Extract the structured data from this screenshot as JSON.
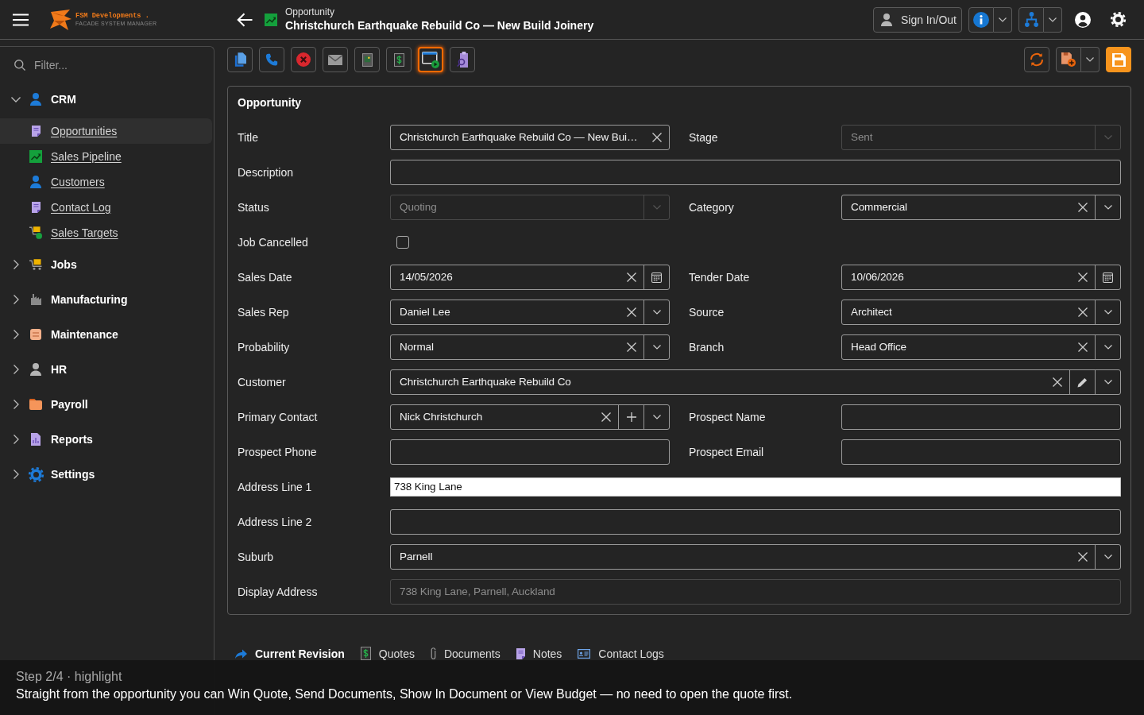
{
  "brand": {
    "name": "FSM Developments .",
    "tagline": "FACADE SYSTEM MANAGER"
  },
  "header": {
    "section": "Opportunity",
    "title": "Christchurch Earthquake Rebuild Co — New Build Joinery"
  },
  "account": {
    "sign_in_label": "Sign In/Out"
  },
  "sidebar": {
    "filter": {
      "placeholder": "Filter..."
    },
    "groups": [
      {
        "label": "CRM",
        "expanded": true,
        "children": [
          {
            "label": "Opportunities",
            "selected": true
          },
          {
            "label": "Sales Pipeline",
            "selected": false
          },
          {
            "label": "Customers",
            "selected": false
          },
          {
            "label": "Contact Log",
            "selected": false
          },
          {
            "label": "Sales Targets",
            "selected": false
          }
        ]
      },
      {
        "label": "Jobs",
        "expanded": false
      },
      {
        "label": "Manufacturing",
        "expanded": false
      },
      {
        "label": "Maintenance",
        "expanded": false
      },
      {
        "label": "HR",
        "expanded": false
      },
      {
        "label": "Payroll",
        "expanded": false
      },
      {
        "label": "Reports",
        "expanded": false
      },
      {
        "label": "Settings",
        "expanded": false
      }
    ]
  },
  "toolbar": {
    "buttons": [
      {
        "highlighted": false
      },
      {
        "highlighted": false
      },
      {
        "highlighted": false
      },
      {
        "highlighted": false
      },
      {
        "highlighted": false
      },
      {
        "highlighted": false
      },
      {
        "highlighted": true
      },
      {
        "highlighted": false
      }
    ]
  },
  "form": {
    "title": "Opportunity",
    "rows": [
      {
        "cells": [
          {
            "label": "Title",
            "kind": "text",
            "value": "Christchurch Earthquake Rebuild Co — New Bui…",
            "disabled": false
          },
          {
            "label": "Stage",
            "kind": "select",
            "value": "Sent",
            "disabled": true
          }
        ]
      },
      {
        "cells": [
          {
            "label": "Description",
            "kind": "text",
            "disabled": false
          }
        ]
      },
      {
        "cells": [
          {
            "label": "Status",
            "kind": "select",
            "value": "Quoting",
            "disabled": true
          },
          {
            "label": "Category",
            "kind": "select",
            "value": "Commercial",
            "disabled": false
          }
        ]
      },
      {
        "cells": [
          {
            "label": "Job Cancelled",
            "kind": "checkbox",
            "checked": false,
            "disabled": false
          }
        ]
      },
      {
        "cells": [
          {
            "label": "Sales Date",
            "kind": "date",
            "value": "14/05/2026",
            "disabled": false
          },
          {
            "label": "Tender Date",
            "kind": "date",
            "value": "10/06/2026",
            "disabled": false
          }
        ]
      },
      {
        "cells": [
          {
            "label": "Sales Rep",
            "kind": "select",
            "value": "Daniel Lee",
            "disabled": false
          },
          {
            "label": "Source",
            "kind": "select",
            "value": "Architect",
            "disabled": false
          }
        ]
      },
      {
        "cells": [
          {
            "label": "Probability",
            "kind": "select",
            "value": "Normal",
            "disabled": false
          },
          {
            "label": "Branch",
            "kind": "select",
            "value": "Head Office",
            "disabled": false
          }
        ]
      },
      {
        "cells": [
          {
            "label": "Customer",
            "kind": "lookup",
            "value": "Christchurch Earthquake Rebuild Co",
            "disabled": false
          }
        ]
      },
      {
        "cells": [
          {
            "label": "Primary Contact",
            "kind": "contact",
            "value": "Nick Christchurch",
            "disabled": false
          },
          {
            "label": "Prospect Name",
            "kind": "text",
            "disabled": false
          }
        ]
      },
      {
        "cells": [
          {
            "label": "Prospect Phone",
            "kind": "text",
            "disabled": false
          },
          {
            "label": "Prospect Email",
            "kind": "text",
            "disabled": false
          }
        ]
      },
      {
        "cells": [
          {
            "label": "Address Line 1",
            "kind": "native",
            "value": "738 King Lane",
            "disabled": false
          }
        ]
      },
      {
        "cells": [
          {
            "label": "Address Line 2",
            "kind": "text",
            "disabled": false
          }
        ]
      },
      {
        "cells": [
          {
            "label": "Suburb",
            "kind": "select",
            "value": "Parnell",
            "disabled": false
          }
        ]
      },
      {
        "cells": [
          {
            "label": "Display Address",
            "kind": "text",
            "value": "738 King Lane, Parnell, Auckland",
            "disabled": true
          }
        ]
      }
    ]
  },
  "tabs": [
    {
      "label": "Current Revision",
      "selected": true
    },
    {
      "label": "Quotes",
      "selected": false
    },
    {
      "label": "Documents",
      "selected": false
    },
    {
      "label": "Notes",
      "selected": false
    },
    {
      "label": "Contact Logs",
      "selected": false
    }
  ],
  "tour": {
    "step": "Step 2/4 · highlight",
    "message": "Straight from the opportunity you can Win Quote, Send Documents, Show In Document or View Budget — no need to open the quote first."
  }
}
